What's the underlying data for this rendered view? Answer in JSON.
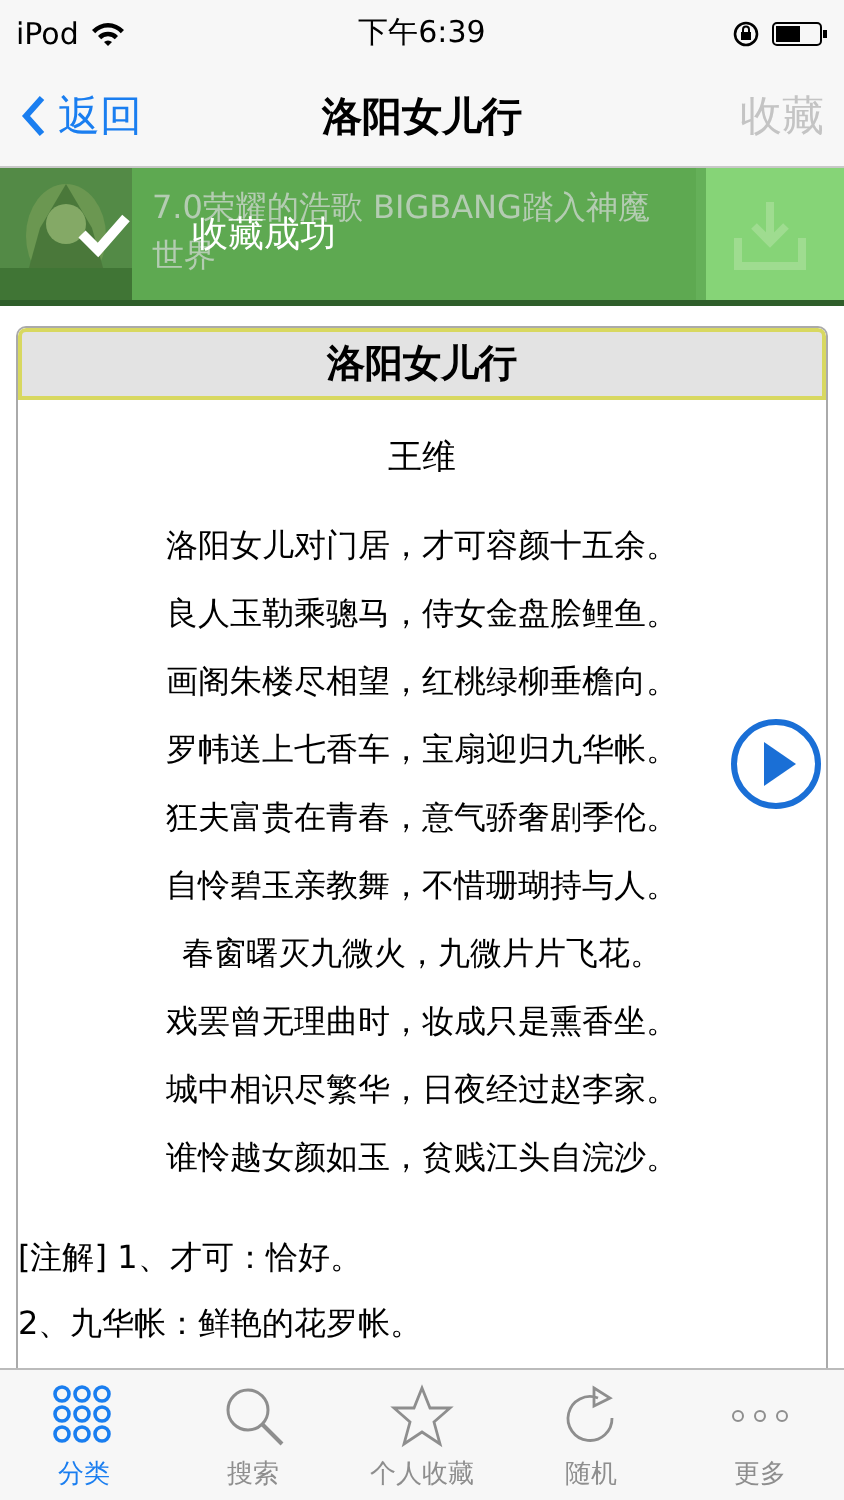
{
  "status_bar": {
    "carrier": "iPod",
    "time": "下午6:39"
  },
  "nav_bar": {
    "back": "返回",
    "title": "洛阳女儿行",
    "action": "收藏",
    "action_disabled": true
  },
  "ad_banner": {
    "lines": [
      "7.0荣耀的浩歌 BIGBANG踏入神魔",
      "世界"
    ]
  },
  "toast": {
    "text": "收藏成功"
  },
  "poem": {
    "title": "洛阳女儿行",
    "author": "王维",
    "lines": [
      "洛阳女儿对门居，才可容颜十五余。",
      "良人玉勒乘骢马，侍女金盘脍鲤鱼。",
      "画阁朱楼尽相望，红桃绿柳垂檐向。",
      "罗帏送上七香车，宝扇迎归九华帐。",
      "狂夫富贵在青春，意气骄奢剧季伦。",
      "自怜碧玉亲教舞，不惜珊瑚持与人。",
      "春窗曙灭九微火，九微片片飞花。",
      "戏罢曾无理曲时，妆成只是熏香坐。",
      "城中相识尽繁华，日夜经过赵李家。",
      "谁怜越女颜如玉，贫贱江头自浣沙。"
    ],
    "notes": [
      "[注解] 1、才可：恰好。",
      "2、九华帐：鲜艳的花罗帐。"
    ]
  },
  "tab_bar": [
    {
      "kind": "grid",
      "label": "分类",
      "selected": true
    },
    {
      "kind": "search",
      "label": "搜索",
      "selected": false
    },
    {
      "kind": "star",
      "label": "个人收藏",
      "selected": false
    },
    {
      "kind": "refresh",
      "label": "随机",
      "selected": false
    },
    {
      "kind": "more",
      "label": "更多",
      "selected": false
    }
  ]
}
